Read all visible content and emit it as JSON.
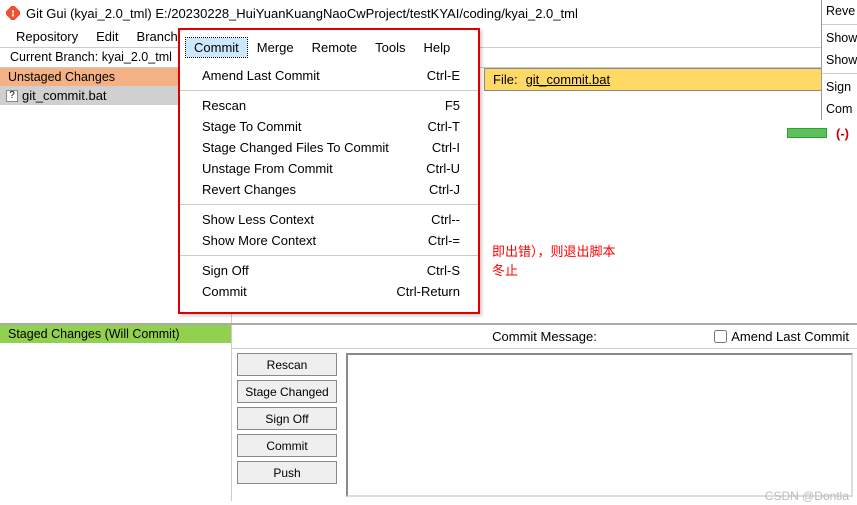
{
  "window": {
    "title": "Git Gui (kyai_2.0_tml) E:/20230228_HuiYuanKuangNaoCwProject/testKYAI/coding/kyai_2.0_tml"
  },
  "menubar": [
    "Repository",
    "Edit",
    "Branch",
    "Commit",
    "Merge",
    "Remote",
    "Tools",
    "Help"
  ],
  "menubar_active_index": 3,
  "branch_label": "Current Branch: kyai_2.0_tml",
  "unstaged": {
    "header": "Unstaged Changes",
    "files": [
      "git_commit.bat"
    ]
  },
  "staged": {
    "header": "Staged Changes (Will Commit)"
  },
  "file_banner": {
    "label": "File:",
    "name": "git_commit.bat"
  },
  "content_text": {
    "line1": "即出错），则退出脚本",
    "line2": "冬止"
  },
  "commit_area": {
    "heading": "Commit Message:",
    "amend_label": "Amend Last Commit",
    "buttons": [
      "Rescan",
      "Stage Changed",
      "Sign Off",
      "Commit",
      "Push"
    ]
  },
  "dropdown": {
    "visible_tabs": [
      "Commit",
      "Merge",
      "Remote",
      "Tools",
      "Help"
    ],
    "groups": [
      [
        {
          "label": "Amend Last Commit",
          "accel": "Ctrl-E"
        }
      ],
      [
        {
          "label": "Rescan",
          "accel": "F5"
        },
        {
          "label": "Stage To Commit",
          "accel": "Ctrl-T"
        },
        {
          "label": "Stage Changed Files To Commit",
          "accel": "Ctrl-I"
        },
        {
          "label": "Unstage From Commit",
          "accel": "Ctrl-U"
        },
        {
          "label": "Revert Changes",
          "accel": "Ctrl-J"
        }
      ],
      [
        {
          "label": "Show Less Context",
          "accel": "Ctrl--"
        },
        {
          "label": "Show More Context",
          "accel": "Ctrl-="
        }
      ],
      [
        {
          "label": "Sign Off",
          "accel": "Ctrl-S"
        },
        {
          "label": "Commit",
          "accel": "Ctrl-Return"
        }
      ]
    ]
  },
  "right_popup": [
    "Reve",
    "Show",
    "Show",
    "Sign",
    "Com"
  ],
  "minus_marker": "(-)",
  "watermark": "CSDN @Dontla"
}
